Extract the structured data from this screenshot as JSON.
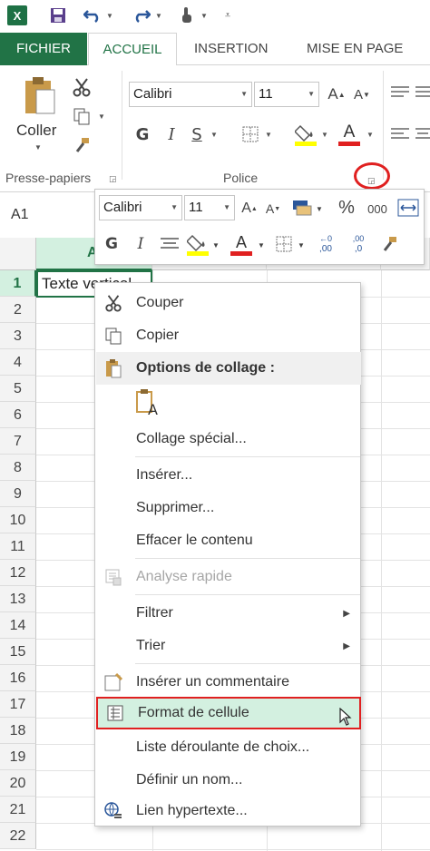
{
  "app": {
    "logo_letter": "X"
  },
  "tabs": [
    {
      "label": "FICHIER"
    },
    {
      "label": "ACCUEIL"
    },
    {
      "label": "INSERTION"
    },
    {
      "label": "MISE EN PAGE"
    }
  ],
  "ribbon": {
    "paste_label": "Coller",
    "clipboard_group": "Presse-papiers",
    "font_group": "Police",
    "font_name": "Calibri",
    "font_size": "11",
    "bold": "G",
    "italic": "I",
    "underline": "S",
    "grow_font": "A",
    "shrink_font": "A",
    "font_color": "A"
  },
  "name_box": "A1",
  "columns": [
    "A"
  ],
  "rows": [
    "1",
    "2",
    "3",
    "4",
    "5",
    "6",
    "7",
    "8",
    "9",
    "10",
    "11",
    "12",
    "13",
    "14",
    "15",
    "16",
    "17",
    "18",
    "19",
    "20",
    "21",
    "22"
  ],
  "cell_a1": "Texte vertical",
  "mini_toolbar": {
    "font_name": "Calibri",
    "font_size": "11",
    "percent": "%",
    "thousands": "000",
    "bold": "G",
    "italic": "I",
    "font_color": "A",
    "inc_decimal": ",00",
    "dec_decimal": ",0"
  },
  "context_menu": {
    "cut": "Couper",
    "copy": "Copier",
    "paste_options": "Options de collage :",
    "paste_special": "Collage spécial...",
    "insert": "Insérer...",
    "delete": "Supprimer...",
    "clear": "Effacer le contenu",
    "quick_analysis": "Analyse rapide",
    "filter": "Filtrer",
    "sort": "Trier",
    "insert_comment": "Insérer un commentaire",
    "format_cells": "Format de cellule",
    "dropdown_list": "Liste déroulante de choix...",
    "define_name": "Définir un nom...",
    "hyperlink": "Lien hypertexte..."
  },
  "colors": {
    "excel_green": "#217346",
    "highlight_red": "#e02020",
    "selection_fill": "#d3f0e0"
  }
}
